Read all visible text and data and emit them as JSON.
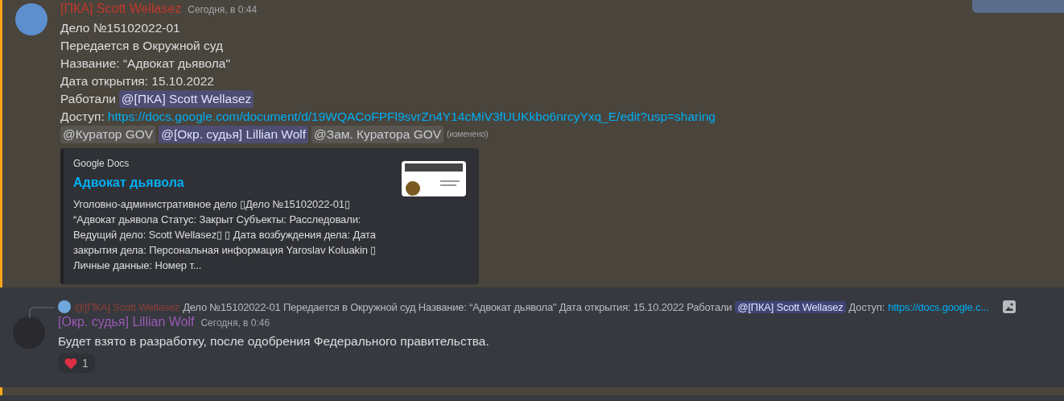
{
  "messages": [
    {
      "highlighted": true,
      "author": "[ПКА] Scott Wellasez",
      "color": "#c0392b",
      "time": "Сегодня, в 0:44",
      "lines": [
        [
          {
            "kind": "text",
            "text": "Дело №15102022-01"
          }
        ],
        [
          {
            "kind": "text",
            "text": "Передается в Окружной суд"
          }
        ],
        [
          {
            "kind": "text",
            "text": "Название: “Адвокат дьявола\""
          }
        ],
        [
          {
            "kind": "text",
            "text": "Дата открытия: 15.10.2022"
          }
        ],
        [
          {
            "kind": "text",
            "text": "Работали"
          },
          {
            "kind": "user_mention",
            "text": "@[ПКА] Scott Wellasez"
          }
        ],
        [
          {
            "kind": "text",
            "text": "Доступ:"
          },
          {
            "kind": "link",
            "text": "https://docs.google.com/document/d/19WQACoFPFl9svrZn4Y14cMiV3fUUKkbo6nrcyYxq_E/edit?usp=sharing"
          }
        ],
        [
          {
            "kind": "role_mention",
            "text": "@Куратор GOV"
          },
          {
            "kind": "user_mention",
            "text": "@[Окр. судья] Lillian Wolf"
          },
          {
            "kind": "role_mention",
            "text": "@Зам. Куратора GOV"
          },
          {
            "kind": "edited",
            "text": "(изменено)"
          }
        ]
      ],
      "embed": {
        "provider": "Google Docs",
        "title": "Адвокат дьявола",
        "description": "Уголовно-административное дело ▯Дело №15102022-01▯ “Адвокат дьявола Статус: Закрыт Субъекты: Расследовали: Ведущий дело: Scott Wellasez▯ ▯ Дата возбуждения дела: Дата закрытия дела: Персональная информация Yaroslav Koluakin ▯ Личные данные: Номер т..."
      }
    },
    {
      "highlighted": false,
      "author": "[Окр. судья] Lillian Wolf",
      "color": "#9b59b6",
      "time": "Сегодня, в 0:46",
      "reply": {
        "author": "@[ПКА] Scott Wellasez",
        "color": "#8e3f37",
        "segments": [
          {
            "kind": "text",
            "text": "Дело №15102022-01 Передается в Окружной суд Название: “Адвокат дьявола\" Дата открытия: 15.10.2022 Работали"
          },
          {
            "kind": "user_mention",
            "text": "@[ПКА] Scott Wellasez"
          },
          {
            "kind": "text",
            "text": "Доступ:"
          },
          {
            "kind": "link",
            "text": "https://docs.google.c..."
          }
        ]
      },
      "lines": [
        [
          {
            "kind": "text",
            "text": "Будет взято в разработку, после одобрения Федерального правительства."
          }
        ]
      ],
      "reactions": [
        {
          "count": "1"
        }
      ]
    }
  ]
}
